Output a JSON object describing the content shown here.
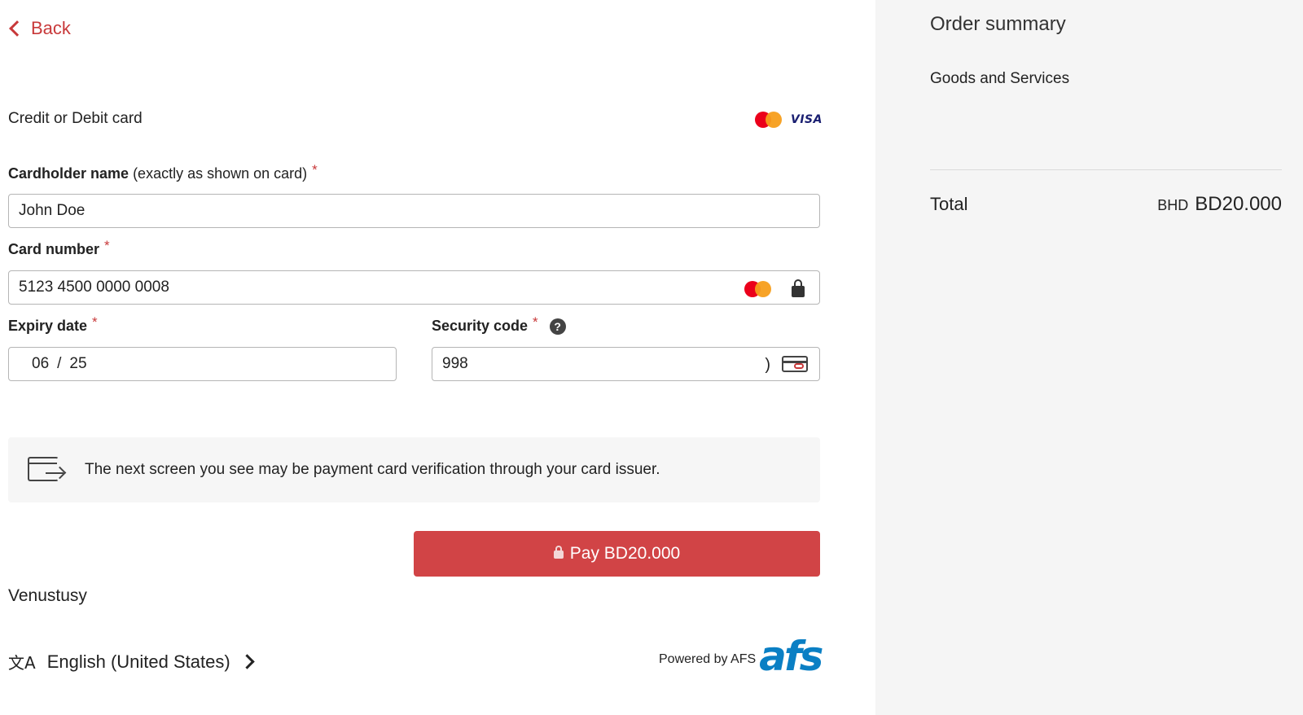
{
  "back_label": "Back",
  "payment": {
    "section_title": "Credit or Debit card",
    "card_brands": [
      "mastercard-logo",
      "visa-logo"
    ],
    "visa_text": "VISA",
    "cardholder": {
      "label_bold": "Cardholder name",
      "label_hint": "(exactly as shown on card)",
      "required_mark": "*",
      "value": "John Doe"
    },
    "card_number": {
      "label": "Card number",
      "required_mark": "*",
      "value": "5123 4500 0000 0008"
    },
    "expiry": {
      "label": "Expiry date",
      "required_mark": "*",
      "month": "06",
      "separator": "/",
      "year": "25"
    },
    "security_code": {
      "label": "Security code",
      "required_mark": "*",
      "help_glyph": "?",
      "value": "998",
      "bracket": ")"
    },
    "notice_text": "The next screen you see may be payment card verification through your card issuer.",
    "pay_button": "Pay BD20.000"
  },
  "merchant_name": "Venustusy",
  "language": {
    "icon_glyph": "文A",
    "label": "English (United States)"
  },
  "powered_by": {
    "text": "Powered by AFS",
    "logo_text": "afs"
  },
  "order_summary": {
    "title": "Order summary",
    "item": "Goods and Services",
    "total_label": "Total",
    "currency": "BHD",
    "total_amount": "BD20.000"
  },
  "colors": {
    "accent": "#c8393a",
    "pay_button": "#d14446",
    "summary_bg": "#f5f5f5",
    "afs_blue": "#0a7fc4"
  }
}
